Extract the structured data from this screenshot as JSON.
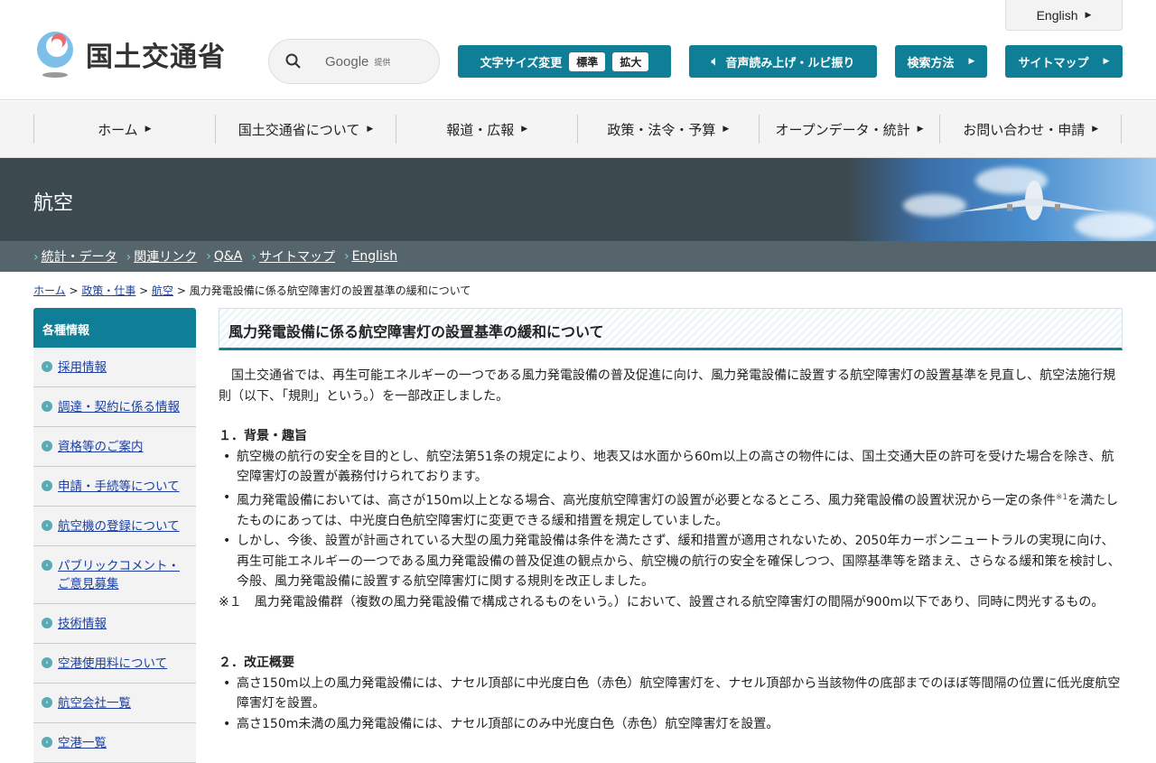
{
  "header": {
    "logo_text": "国土交通省",
    "search_brand": "Google",
    "search_provided": "提供",
    "english": "English",
    "font_size_label": "文字サイズ変更",
    "font_standard": "標準",
    "font_large": "拡大",
    "speech": "音声読み上げ・ルビ振り",
    "search_method": "検索方法",
    "sitemap": "サイトマップ"
  },
  "gnav": [
    "ホーム",
    "国土交通省について",
    "報道・広報",
    "政策・法令・予算",
    "オープンデータ・統計",
    "お問い合わせ・申請"
  ],
  "banner": {
    "title": "航空"
  },
  "subnav": [
    "統計・データ",
    "関連リンク",
    "Q&A",
    "サイトマップ",
    "English"
  ],
  "breadcrumb": {
    "links": [
      "ホーム",
      "政策・仕事",
      "航空"
    ],
    "current": "風力発電設備に係る航空障害灯の設置基準の緩和について"
  },
  "sidebar": {
    "title": "各種情報",
    "items": [
      "採用情報",
      "調達・契約に係る情報",
      "資格等のご案内",
      "申請・手続等について",
      "航空機の登録について",
      "パブリックコメント・ご意見募集",
      "技術情報",
      "空港使用料について",
      "航空会社一覧",
      "空港一覧"
    ]
  },
  "main": {
    "title": "風力発電設備に係る航空障害灯の設置基準の緩和について",
    "intro": "　国土交通省では、再生可能エネルギーの一つである風力発電設備の普及促進に向け、風力発電設備に設置する航空障害灯の設置基準を見直し、航空法施行規則（以下、「規則」という。）を一部改正しました。",
    "s1_heading": "１．背景・趣旨",
    "s1_b1": "航空機の航行の安全を目的とし、航空法第51条の規定により、地表又は水面から60m以上の高さの物件には、国土交通大臣の許可を受けた場合を除き、航空障害灯の設置が義務付けられております。",
    "s1_b2a": "風力発電設備においては、高さが150m以上となる場合、高光度航空障害灯の設置が必要となるところ、風力発電設備の設置状況から一定の条件",
    "s1_b2sup": "※1",
    "s1_b2b": "を満たしたものにあっては、中光度白色航空障害灯に変更できる緩和措置を規定していました。",
    "s1_b3": "しかし、今後、設置が計画されている大型の風力発電設備は条件を満たさず、緩和措置が適用されないため、2050年カーボンニュートラルの実現に向け、再生可能エネルギーの一つである風力発電設備の普及促進の観点から、航空機の航行の安全を確保しつつ、国際基準等を踏まえ、さらなる緩和策を検討し、今般、風力発電設備に設置する航空障害灯に関する規則を改正しました。",
    "s1_note": "※１　風力発電設備群（複数の風力発電設備で構成されるものをいう。）において、設置される航空障害灯の間隔が900m以下であり、同時に閃光するもの。",
    "s2_heading": "２．改正概要",
    "s2_b1": "高さ150m以上の風力発電設備には、ナセル頂部に中光度白色（赤色）航空障害灯を、ナセル頂部から当該物件の底部までのほぼ等間隔の位置に低光度航空障害灯を設置。",
    "s2_b2": "高さ150m未満の風力発電設備には、ナセル頂部にのみ中光度白色（赤色）航空障害灯を設置。"
  },
  "colors": {
    "accent": "#0e7f96",
    "banner": "#3c4a50",
    "subnav": "#56646b"
  }
}
